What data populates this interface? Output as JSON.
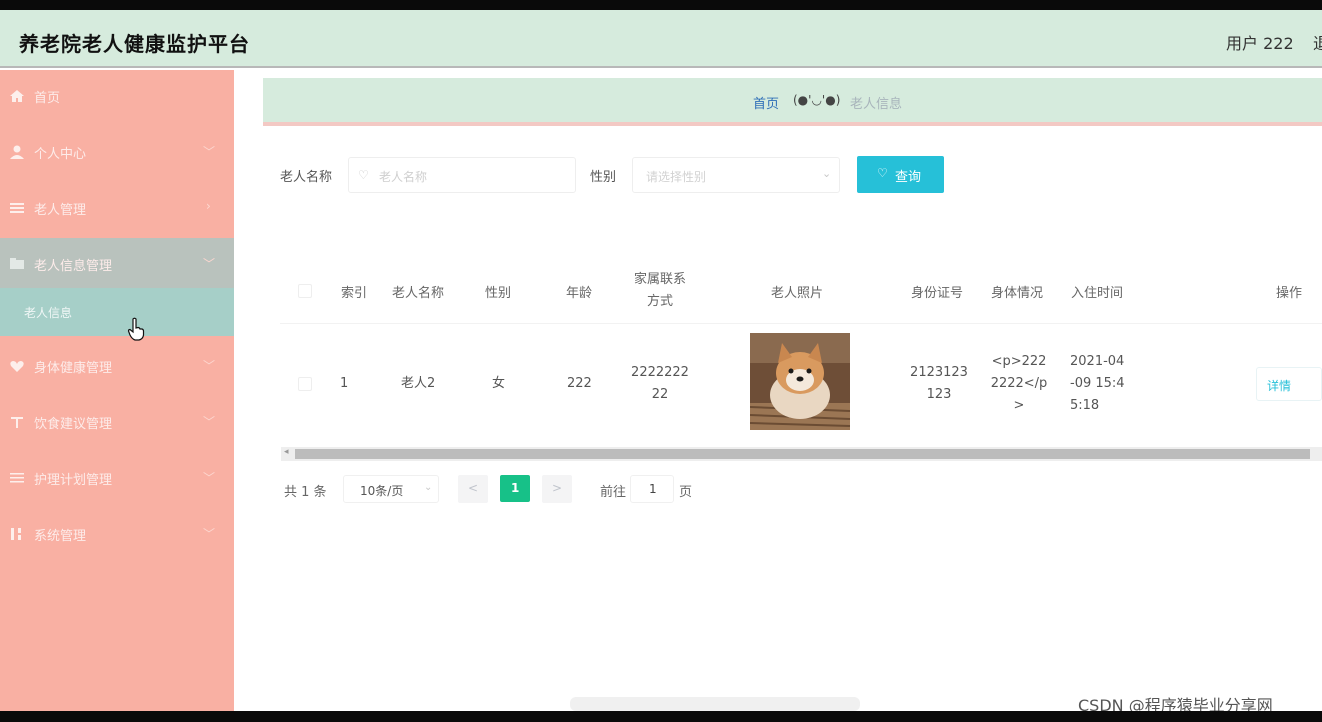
{
  "app": {
    "title": "养老院老人健康监护平台",
    "user_label": "用户 222",
    "logout_label": "退出登录"
  },
  "sidebar": {
    "items": [
      {
        "label": "首页",
        "icon": "home-icon"
      },
      {
        "label": "个人中心",
        "icon": "user-icon"
      },
      {
        "label": "老人管理",
        "icon": "list-icon"
      },
      {
        "label": "老人信息管理",
        "icon": "folder-icon"
      },
      {
        "label": "身体健康管理",
        "icon": "heart-icon"
      },
      {
        "label": "饮食建议管理",
        "icon": "food-icon"
      },
      {
        "label": "护理计划管理",
        "icon": "doc-icon"
      },
      {
        "label": "系统管理",
        "icon": "settings-icon"
      }
    ],
    "sub_item": {
      "label": "老人信息"
    }
  },
  "breadcrumb": {
    "home": "首页",
    "face": "(●'◡'●)",
    "current": "老人信息"
  },
  "search": {
    "name_label": "老人名称",
    "name_placeholder": "老人名称",
    "gender_label": "性别",
    "gender_placeholder": "请选择性别",
    "query_label": "查询"
  },
  "table": {
    "headers": {
      "index": "索引",
      "name": "老人名称",
      "gender": "性别",
      "age": "年龄",
      "phone_line1": "家属联系",
      "phone_line2": "方式",
      "photo": "老人照片",
      "id_card": "身份证号",
      "health": "身体情况",
      "checkin": "入住时间",
      "action": "操作"
    },
    "rows": [
      {
        "index": "1",
        "name": "老人2",
        "gender": "女",
        "age": "222",
        "phone_line1": "2222222",
        "phone_line2": "22",
        "id_line1": "2123123",
        "id_line2": "123",
        "health_line1": "<p>222",
        "health_line2": "2222</p",
        "health_line3": ">",
        "checkin_line1": "2021-04",
        "checkin_line2": "-09 15:4",
        "checkin_line3": "5:18",
        "detail_label": "详情"
      }
    ]
  },
  "pagination": {
    "total": "共 1 条",
    "page_size": "10条/页",
    "prev": "<",
    "current_page": "1",
    "next": ">",
    "goto_label": "前往",
    "goto_value": "1",
    "page_suffix": "页"
  },
  "watermark": "CSDN @程序猿毕业分享网",
  "colors": {
    "header_bg": "#d6ebdd",
    "sidebar_bg": "#f9b0a3",
    "accent_cyan": "#26c0d8",
    "page_active": "#17c188"
  }
}
